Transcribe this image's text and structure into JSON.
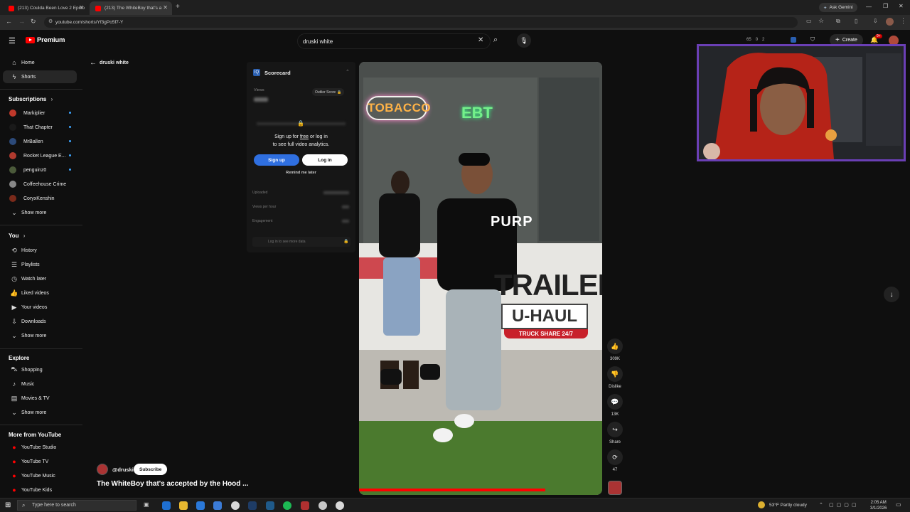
{
  "browser": {
    "tabs": [
      {
        "title": "(213) Coulda Been Love 2 Episo"
      },
      {
        "title": "(213) The WhiteBoy that's a"
      }
    ],
    "url": "youtube.com/shorts/Yf3gPo5f7-Y",
    "ask_gemini": "Ask Gemini"
  },
  "header": {
    "logo_text": "Premium",
    "search_value": "druski white",
    "create_label": "Create",
    "notif_count": "9+",
    "ext_stats": [
      "65",
      "0",
      "2"
    ]
  },
  "sidebar": {
    "main": [
      {
        "label": "Home",
        "icon": "home-icon"
      },
      {
        "label": "Shorts",
        "icon": "shorts-icon"
      }
    ],
    "subscriptions_title": "Subscriptions",
    "subscriptions": [
      {
        "label": "Markiplier",
        "color": "#c0392b",
        "dot": true
      },
      {
        "label": "That Chapter",
        "color": "#1a1a1a",
        "dot": true
      },
      {
        "label": "MrBallen",
        "color": "#2c4a7a",
        "dot": true
      },
      {
        "label": "Rocket League E...",
        "color": "#b03a2e",
        "dot": true
      },
      {
        "label": "penguinz0",
        "color": "#4b5a3a",
        "dot": true
      },
      {
        "label": "Coffeehouse Crime",
        "color": "#888888",
        "dot": false
      },
      {
        "label": "CoryxKenshin",
        "color": "#7a2a1a",
        "dot": false
      }
    ],
    "sub_show_more": "Show more",
    "you_title": "You",
    "you": [
      {
        "label": "History",
        "icon": "history-icon"
      },
      {
        "label": "Playlists",
        "icon": "playlists-icon"
      },
      {
        "label": "Watch later",
        "icon": "watch-later-icon"
      },
      {
        "label": "Liked videos",
        "icon": "liked-videos-icon"
      },
      {
        "label": "Your videos",
        "icon": "your-videos-icon"
      },
      {
        "label": "Downloads",
        "icon": "downloads-icon"
      }
    ],
    "you_show_more": "Show more",
    "explore_title": "Explore",
    "explore": [
      {
        "label": "Shopping",
        "icon": "shopping-icon"
      },
      {
        "label": "Music",
        "icon": "music-icon"
      },
      {
        "label": "Movies & TV",
        "icon": "movies-icon"
      }
    ],
    "explore_show_more": "Show more",
    "more_title": "More from YouTube",
    "more": [
      {
        "label": "YouTube Studio"
      },
      {
        "label": "YouTube TV"
      },
      {
        "label": "YouTube Music"
      },
      {
        "label": "YouTube Kids"
      }
    ]
  },
  "back": {
    "label": "druski white"
  },
  "scorecard": {
    "title": "Scorecard",
    "views_label": "Views",
    "outlier_label": "Outlier Score",
    "signup_text_1": "Sign up for ",
    "signup_free": "free",
    "signup_text_2": " or log in",
    "signup_text_3": "to see full video analytics.",
    "signup_button": "Sign up",
    "login_button": "Log in",
    "remind": "Remind me later",
    "uploaded_label": "Uploaded",
    "views_per_hour_label": "Views per hour",
    "engagement_label": "Engagement",
    "login_more": "Log in to see more data"
  },
  "video": {
    "signs": {
      "tobacco": "TOBACCO",
      "ebt": "EBT",
      "trailers": "TRAILERS",
      "uhaul": "U-HAUL",
      "truckshare": "TRUCK SHARE 24/7",
      "shirt": "PURP"
    },
    "channel": "@druski",
    "subscribe": "Subscribe",
    "title": "The WhiteBoy that's accepted by the Hood ..."
  },
  "actions": {
    "likes": "309K",
    "dislike": "Dislike",
    "comments": "13K",
    "share": "Share",
    "remix": "47"
  },
  "taskbar": {
    "search_placeholder": "Type here to search",
    "weather": "53°F  Partly cloudy",
    "time": "2:05 AM",
    "date": "3/1/2026"
  }
}
